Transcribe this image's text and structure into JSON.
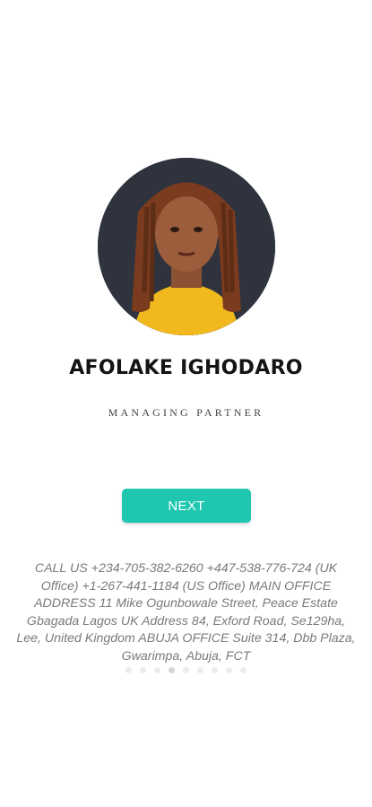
{
  "profile": {
    "name": "AFOLAKE IGHODARO",
    "role": "MANAGING PARTNER"
  },
  "actions": {
    "next_label": "NEXT"
  },
  "contact": {
    "text": "CALL US +234-705-382-6260 +447-538-776-724 (UK Office) +1-267-441-1184 (US Office) MAIN OFFICE ADDRESS 11 Mike Ogunbowale Street, Peace Estate Gbagada Lagos UK Address 84, Exford Road, Se129ha, Lee, United Kingdom ABUJA OFFICE Suite 314, Dbb Plaza, Gwarimpa, Abuja, FCT"
  },
  "pager": {
    "total": 9,
    "current": 4
  },
  "colors": {
    "accent": "#1fc7b0",
    "name_text": "#141414",
    "contact_text": "#7a7a7a"
  }
}
